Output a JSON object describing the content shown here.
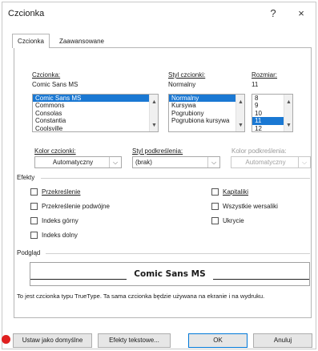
{
  "window": {
    "title": "Czcionka",
    "help_label": "?",
    "close_label": "×"
  },
  "tabs": [
    {
      "label": "Czcionka",
      "selected": true
    },
    {
      "label": "Zaawansowane",
      "selected": false
    }
  ],
  "font": {
    "label": "Czcionka:",
    "value": "Comic Sans MS",
    "items": [
      "Comic Sans MS",
      "Commons",
      "Consolas",
      "Constantia",
      "Coolsville"
    ],
    "selected": "Comic Sans MS"
  },
  "style": {
    "label": "Styl czcionki:",
    "value": "Normalny",
    "items": [
      "Normalny",
      "Kursywa",
      "Pogrubiony",
      "Pogrubiona kursywa"
    ],
    "selected": "Normalny"
  },
  "size": {
    "label": "Rozmiar:",
    "value": "11",
    "items": [
      "8",
      "9",
      "10",
      "11",
      "12"
    ],
    "selected": "11"
  },
  "font_color": {
    "label": "Kolor czcionki:",
    "value": "Automatyczny"
  },
  "underline_style": {
    "label": "Styl podkreślenia:",
    "value": "(brak)"
  },
  "underline_color": {
    "label": "Kolor podkreślenia:",
    "value": "Automatyczny"
  },
  "effects": {
    "label": "Efekty",
    "left": [
      {
        "label": "Przekreślenie",
        "checked": false
      },
      {
        "label": "Przekreślenie podwójne",
        "checked": false
      },
      {
        "label": "Indeks górny",
        "checked": false
      },
      {
        "label": "Indeks dolny",
        "checked": false
      }
    ],
    "right": [
      {
        "label": "Kapitaliki",
        "checked": false
      },
      {
        "label": "Wszystkie wersaliki",
        "checked": false
      },
      {
        "label": "Ukrycie",
        "checked": false
      }
    ]
  },
  "preview": {
    "label": "Podgląd",
    "sample": "Comic Sans MS",
    "note": "To jest czcionka typu TrueType. Ta sama czcionka będzie używana na ekranie i na wydruku."
  },
  "buttons": {
    "set_default": "Ustaw jako domyślne",
    "text_effects": "Efekty tekstowe...",
    "ok": "OK",
    "cancel": "Anuluj"
  },
  "colors": {
    "selection": "#1a78d3",
    "marker": "#e02020",
    "default_button_border": "#0078d7"
  }
}
